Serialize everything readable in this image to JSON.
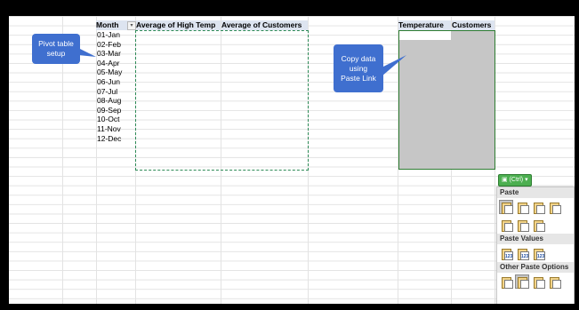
{
  "pivot": {
    "header_month": "Month",
    "header_high_temp": "Average of High Temp",
    "header_customers": "Average of Customers",
    "filter_icon": "dropdown-filter-icon",
    "months": [
      "01-Jan",
      "02-Feb",
      "03-Mar",
      "04-Apr",
      "05-May",
      "06-Jun",
      "07-Jul",
      "08-Aug",
      "09-Sep",
      "10-Oct",
      "11-Nov",
      "12-Dec"
    ]
  },
  "target": {
    "header_temperature": "Temperature",
    "header_customers": "Customers"
  },
  "callouts": {
    "left": [
      "Pivot table",
      "setup"
    ],
    "right": [
      "Copy data",
      "using",
      "Paste Link"
    ]
  },
  "paste_menu": {
    "ctrl_label": "(Ctrl) ▾",
    "section_paste": "Paste",
    "section_values": "Paste Values",
    "section_other": "Other Paste Options",
    "paste_icons": [
      "paste-icon",
      "paste-formulas-icon",
      "paste-formulas-number-formatting-icon",
      "keep-source-formatting-icon",
      "no-borders-icon",
      "keep-column-widths-icon",
      "transpose-icon"
    ],
    "values_icons": [
      "paste-values-icon",
      "values-number-formatting-icon",
      "values-source-formatting-icon"
    ],
    "other_icons": [
      "formatting-icon",
      "paste-link-icon",
      "picture-icon",
      "linked-picture-icon"
    ]
  },
  "colors": {
    "callout": "#3f6fcf",
    "marquee": "#2e8b57",
    "selection": "#c6c6c6",
    "ctrl_button": "#4caf50"
  }
}
